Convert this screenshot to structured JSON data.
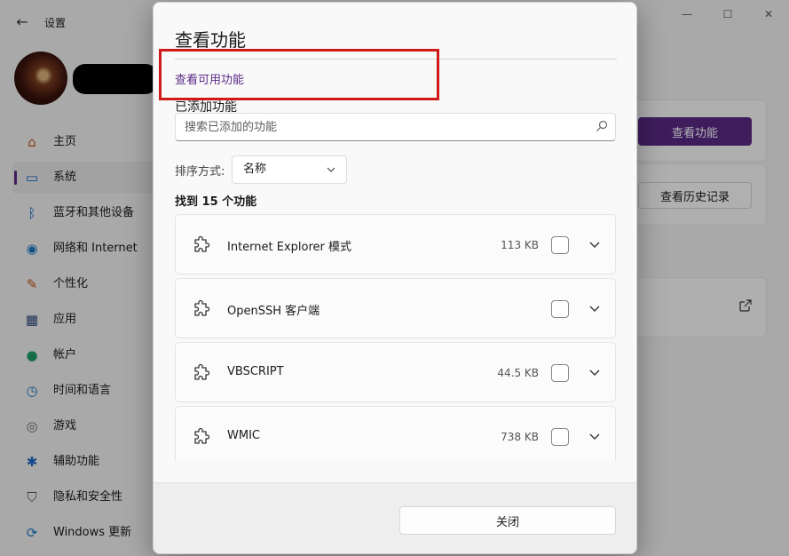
{
  "window": {
    "back_glyph": "←",
    "title": "设置",
    "controls": [
      "—",
      "☐",
      "✕"
    ]
  },
  "sidebar": {
    "items": [
      {
        "label": "主页",
        "icon": "home-icon",
        "glyph": "⌂",
        "color": "#c25a1a"
      },
      {
        "label": "系统",
        "icon": "system-icon",
        "glyph": "▭",
        "color": "#0b66c2"
      },
      {
        "label": "蓝牙和其他设备",
        "icon": "bluetooth-icon",
        "glyph": "ᛒ",
        "color": "#0b66c2"
      },
      {
        "label": "网络和 Internet",
        "icon": "wifi-icon",
        "glyph": "◉",
        "color": "#1a78c2"
      },
      {
        "label": "个性化",
        "icon": "brush-icon",
        "glyph": "✎",
        "color": "#c2531a"
      },
      {
        "label": "应用",
        "icon": "apps-icon",
        "glyph": "▦",
        "color": "#2c4a7a"
      },
      {
        "label": "帐户",
        "icon": "account-icon",
        "glyph": "●",
        "color": "#1f9e6a"
      },
      {
        "label": "时间和语言",
        "icon": "clock-globe-icon",
        "glyph": "◷",
        "color": "#1a78c2"
      },
      {
        "label": "游戏",
        "icon": "gamepad-icon",
        "glyph": "◎",
        "color": "#6a6a6a"
      },
      {
        "label": "辅助功能",
        "icon": "accessibility-icon",
        "glyph": "✱",
        "color": "#1a6ac2"
      },
      {
        "label": "隐私和安全性",
        "icon": "shield-icon",
        "glyph": "⛉",
        "color": "#5a5a5a"
      },
      {
        "label": "Windows 更新",
        "icon": "update-icon",
        "glyph": "⟳",
        "color": "#1a78c2"
      }
    ],
    "active_index": 1
  },
  "background": {
    "view_features_button": "查看功能",
    "view_history_button": "查看历史记录"
  },
  "dialog": {
    "title": "查看功能",
    "tab_link": "查看可用功能",
    "section_label": "已添加功能",
    "search_placeholder": "搜索已添加的功能",
    "sort_label": "排序方式:",
    "sort_value": "名称",
    "count_text": "找到 15 个功能",
    "features": [
      {
        "name": "Internet Explorer 模式",
        "size": "113 KB"
      },
      {
        "name": "OpenSSH 客户端",
        "size": ""
      },
      {
        "name": "VBSCRIPT",
        "size": "44.5 KB"
      },
      {
        "name": "WMIC",
        "size": "738 KB"
      }
    ],
    "close_button": "关闭"
  },
  "colors": {
    "accent": "#5b2a86",
    "highlight": "#d01a1a"
  }
}
